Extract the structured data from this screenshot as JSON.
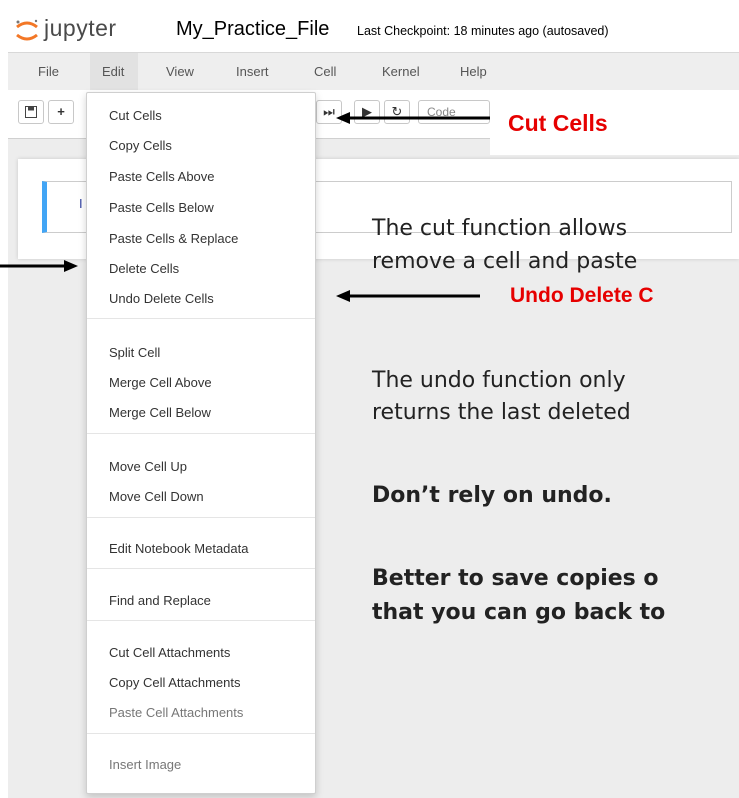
{
  "header": {
    "logo_text": "jupyter",
    "notebook_name": "My_Practice_File",
    "checkpoint": "Last Checkpoint: 18 minutes ago (autosaved)"
  },
  "menubar": [
    "File",
    "Edit",
    "View",
    "Insert",
    "Cell",
    "Kernel",
    "Help"
  ],
  "toolbar": {
    "save_icon": "floppy-disk-icon",
    "add_label": "+",
    "step_label": "⏭",
    "run_label": "▶",
    "restart_label": "↻",
    "cell_type": "Code"
  },
  "cell": {
    "prompt": "I"
  },
  "edit_menu": {
    "items": [
      "Cut Cells",
      "Copy Cells",
      "Paste Cells Above",
      "Paste Cells Below",
      "Paste Cells & Replace",
      "Delete Cells",
      "Undo Delete Cells",
      "Split Cell",
      "Merge Cell Above",
      "Merge Cell Below",
      "Move Cell Up",
      "Move Cell Down",
      "Edit Notebook Metadata",
      "Find and Replace",
      "Cut Cell Attachments",
      "Copy Cell Attachments",
      "Paste Cell Attachments",
      "Insert Image"
    ]
  },
  "annotations": {
    "cut_label": "Cut Cells",
    "cut_desc_1": "The cut function allows",
    "cut_desc_2": "remove a cell and paste",
    "undo_label": "Undo Delete C",
    "undo_desc_1": "The undo function only",
    "undo_desc_2": "returns the last deleted",
    "warning": "Don’t rely on undo.",
    "advice_1": "Better to save copies o",
    "advice_2": "that you can go back to"
  },
  "colors": {
    "accent_red": "#e60000",
    "cell_border_blue": "#42a5f5",
    "logo_orange": "#f37726"
  }
}
